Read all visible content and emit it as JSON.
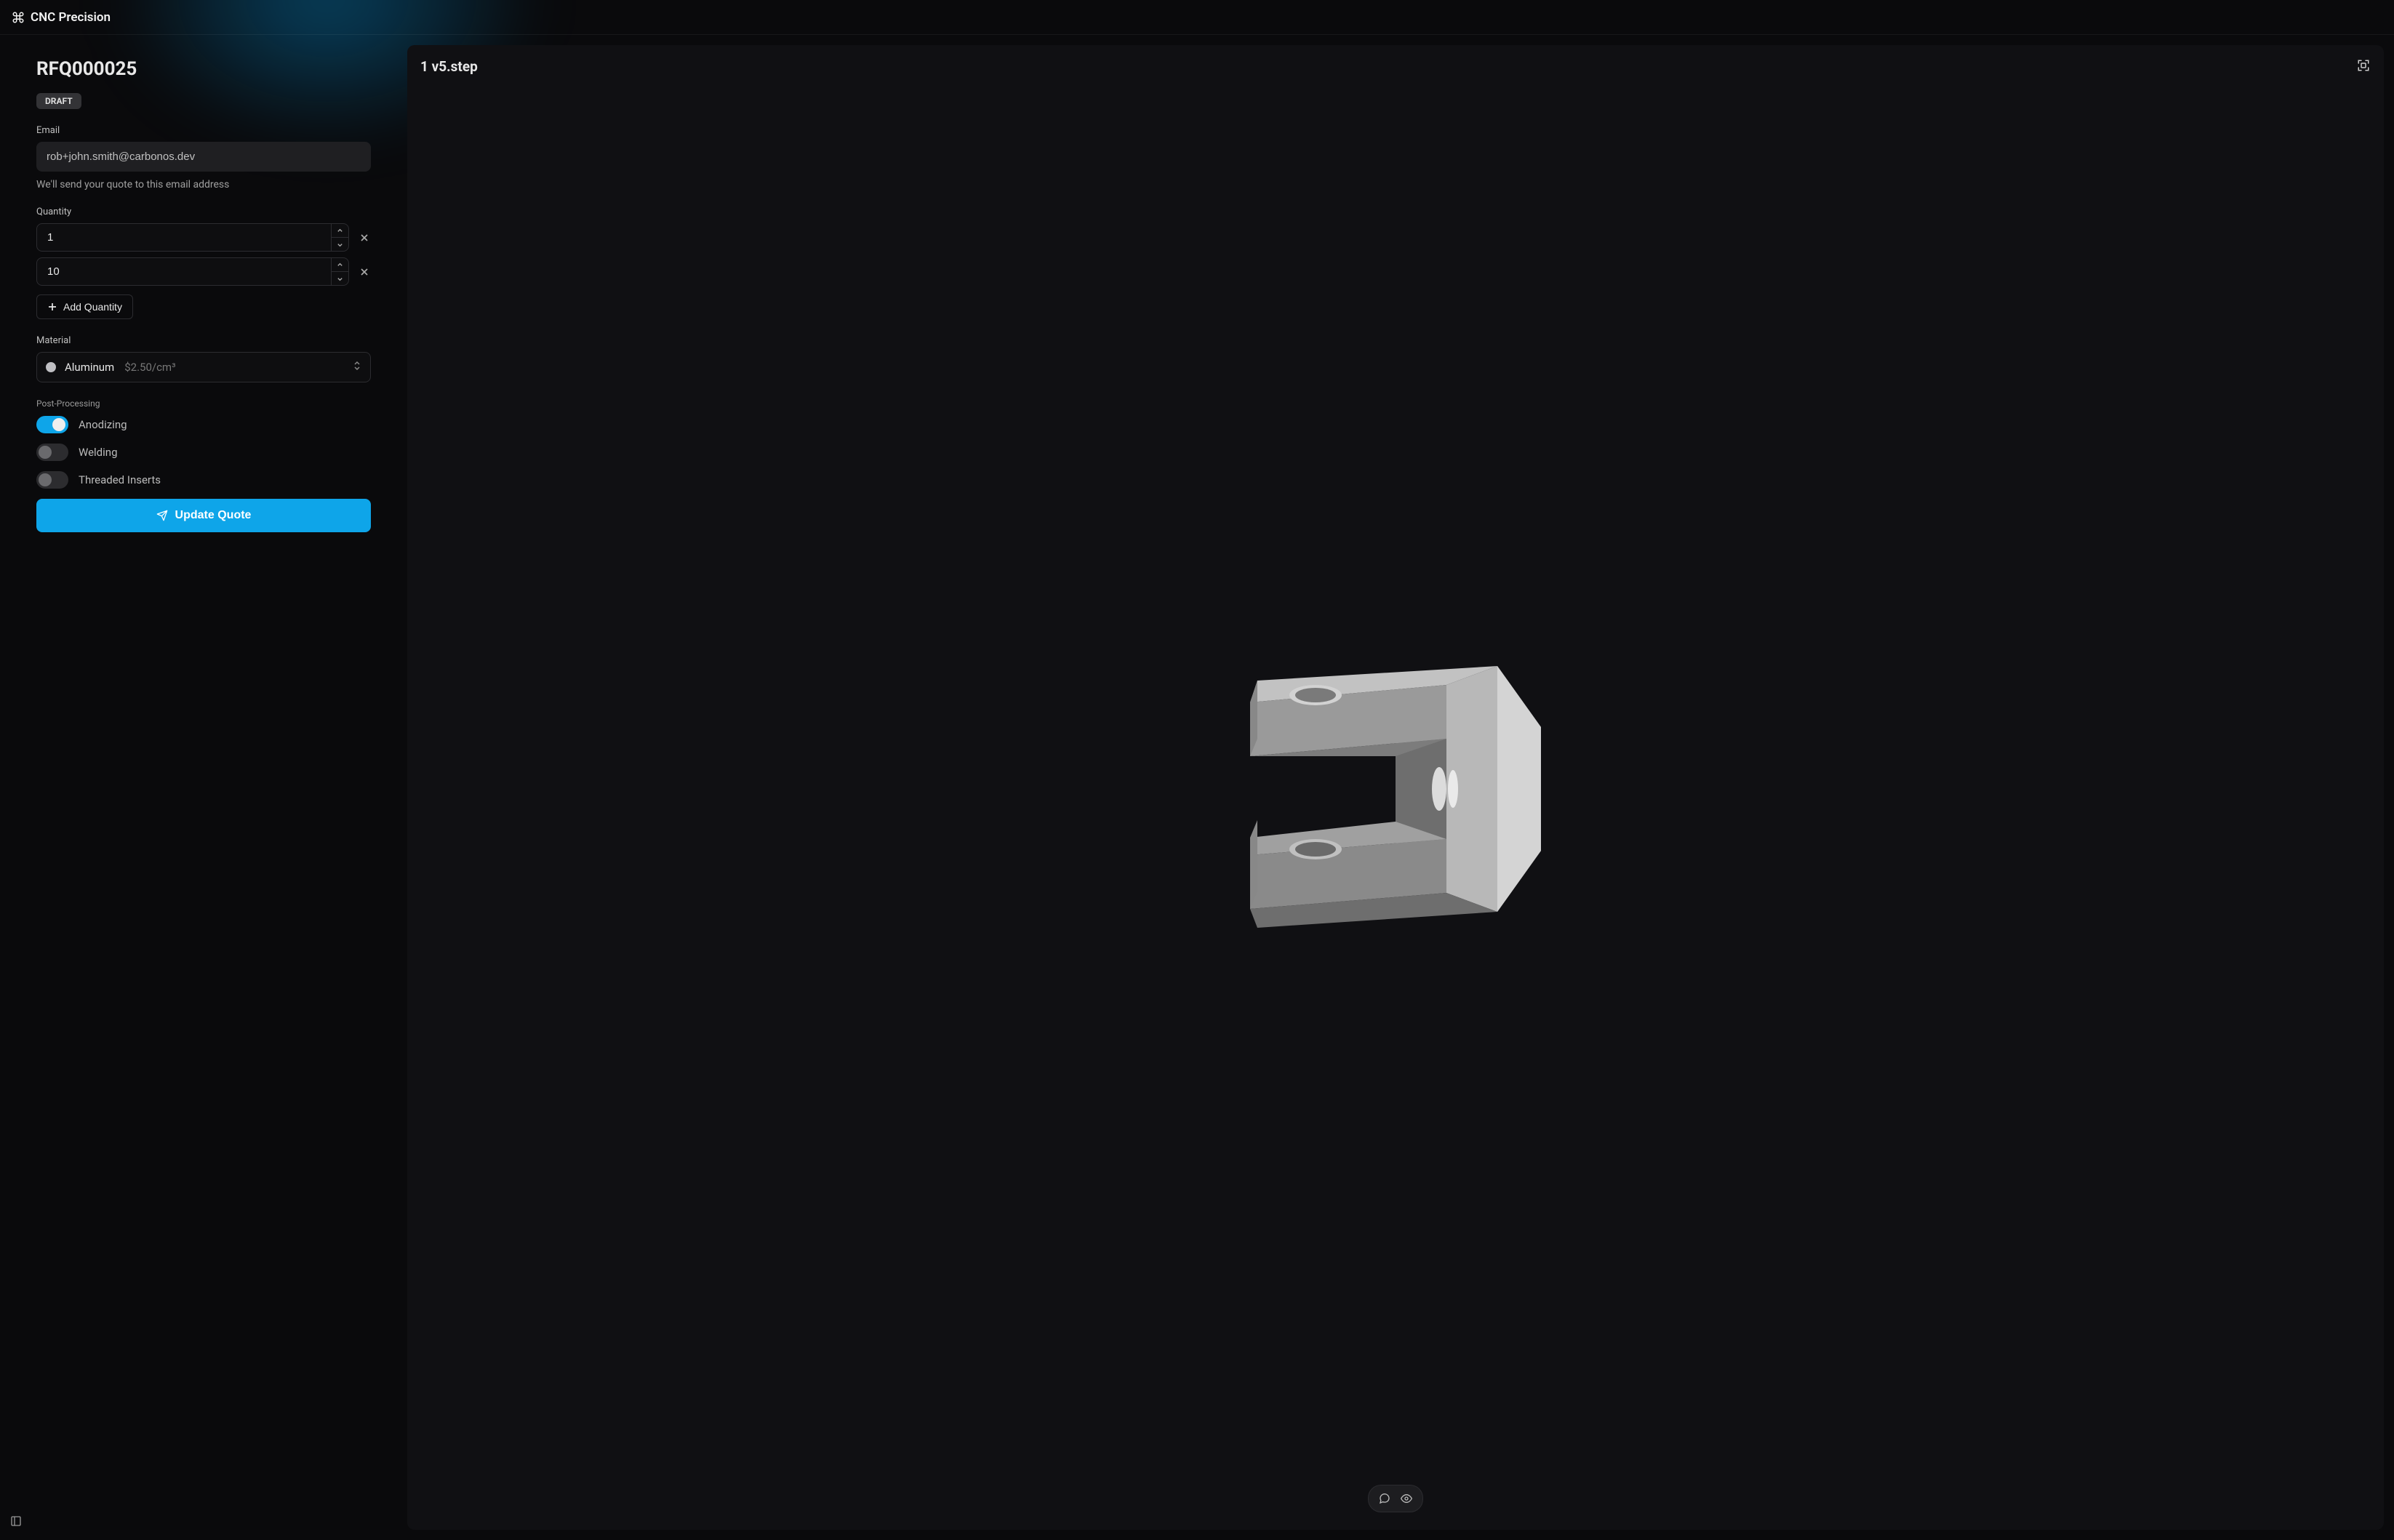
{
  "app": {
    "name": "CNC Precision"
  },
  "rfq": {
    "title": "RFQ000025",
    "status_badge": "DRAFT"
  },
  "form": {
    "email_label": "Email",
    "email_value": "rob+john.smith@carbonos.dev",
    "email_helper": "We'll send your quote to this email address",
    "quantity_label": "Quantity",
    "quantities": [
      {
        "value": "1"
      },
      {
        "value": "10"
      }
    ],
    "add_quantity_label": "Add Quantity",
    "material_label": "Material",
    "material_selected": "Aluminum",
    "material_price": "$2.50/cm³",
    "postprocessing_label": "Post-Processing",
    "postprocessing": [
      {
        "label": "Anodizing",
        "on": true
      },
      {
        "label": "Welding",
        "on": false
      },
      {
        "label": "Threaded Inserts",
        "on": false
      }
    ],
    "submit_label": "Update Quote"
  },
  "viewer": {
    "filename": "1 v5.step"
  }
}
